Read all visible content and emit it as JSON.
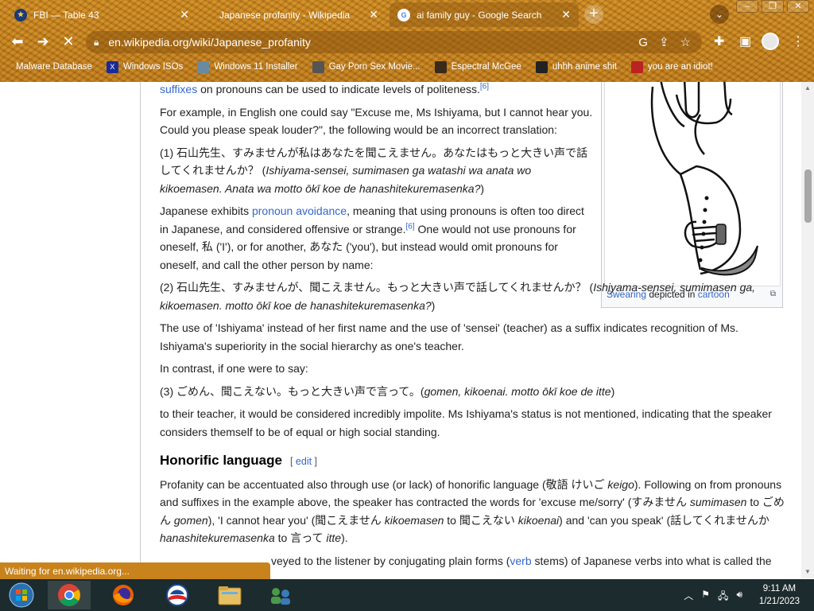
{
  "browser": {
    "tabs": [
      {
        "title": "FBI — Table 43",
        "active": false
      },
      {
        "title": "Japanese profanity - Wikipedia",
        "active": false
      },
      {
        "title": "ai family guy - Google Search",
        "active": true
      }
    ],
    "new_tab": "+",
    "url": "en.wikipedia.org/wiki/Japanese_profanity",
    "bookmarks": [
      {
        "label": "Malware Database"
      },
      {
        "label": "Windows ISOs"
      },
      {
        "label": "Windows 11 Installer"
      },
      {
        "label": "Gay Porn Sex Movie..."
      },
      {
        "label": "Espectral McGee"
      },
      {
        "label": "uhhh anime shit"
      },
      {
        "label": "you are an idiot!"
      }
    ],
    "status": "Waiting for en.wikipedia.org..."
  },
  "article": {
    "p0_link": "suffixes",
    "p0_text": " on pronouns can be used to indicate levels of politeness.",
    "p0_ref": "[6]",
    "p1": "For example, in English one could say \"Excuse me, Ms Ishiyama, but I cannot hear you. Could you please speak louder?\", the following would be an incorrect translation:",
    "ex1_jp": "(1) 石山先生、すみませんが私はあなたを聞こえません。あなたはもっと大きい声で話してくれませんか？",
    "ex1_romaji": "Ishiyama-sensei, sumimasen ga watashi wa anata wo kikoemasen. Anata wa motto ōkī koe de hanashitekuremasenka?",
    "p2_a": "Japanese exhibits ",
    "p2_link": "pronoun avoidance",
    "p2_b": ", meaning that using pronouns is often too direct in Japanese, and considered offensive or strange.",
    "p2_ref": "[6]",
    "p2_c": " One would not use pronouns for oneself, 私 ('I'), or for another, あなた ('you'), but instead would omit pronouns for oneself, and call the other person by name:",
    "ex2_jp": "(2) 石山先生、すみませんが、聞こえません。もっと大きい声で話してくれませんか？",
    "ex2_romaji": "Ishiyama-sensei, sumimasen ga, kikoemasen. motto ōkī koe de hanashitekuremasenka?",
    "p3": "The use of 'Ishiyama' instead of her first name and the use of 'sensei' (teacher) as a suffix indicates recognition of Ms. Ishiyama's superiority in the social hierarchy as one's teacher.",
    "p4": "In contrast, if one were to say:",
    "ex3_jp": "(3) ごめん、聞こえない。もっと大きい声で言って。",
    "ex3_romaji": "gomen, kikoenai. motto ōkī koe de itte",
    "p5": "to their teacher, it would be considered incredibly impolite. Ms Ishiyama's status is not mentioned, indicating that the speaker considers themself to be of equal or high social standing.",
    "h2": "Honorific language",
    "edit": "edit",
    "p6_a": "Profanity can be accentuated also through use (or lack) of honorific language (敬語 けいご ",
    "p6_keigo": "keigo",
    "p6_b": "). Following on from pronouns and suffixes in the example above, the speaker has contracted the words for 'excuse me/sorry' (すみません ",
    "p6_sumimasen": "sumimasen",
    "p6_c": " to ごめん ",
    "p6_gomen": "gomen",
    "p6_d": "), 'I cannot hear you' (聞こえません ",
    "p6_kikoemasen": "kikoemasen",
    "p6_e": " to 聞こえない ",
    "p6_kikoenai": "kikoenai",
    "p6_f": ") and 'can you speak' (話してくれませんか ",
    "p6_hanashite": "hanashitekuremasenka",
    "p6_g": " to 言って ",
    "p6_itte": "itte",
    "p6_h": ").",
    "p7_a": "veyed to the listener by conjugating plain forms (",
    "p7_link": "verb",
    "p7_b": " stems) of Japanese verbs into what is called the",
    "caption_link1": "Swearing",
    "caption_mid": " depicted in ",
    "caption_link2": "cartoon"
  },
  "taskbar": {
    "time": "9:11 AM",
    "date": "1/21/2023"
  },
  "colors": {
    "chrome": "#c8831c",
    "link": "#3366cc",
    "taskbar": "#1c2b2d"
  }
}
